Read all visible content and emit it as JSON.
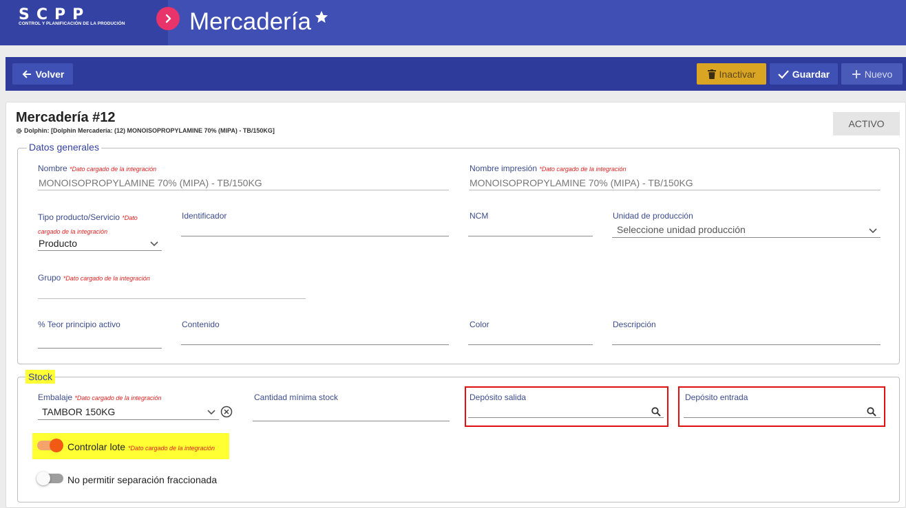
{
  "header": {
    "logo": "SCPP",
    "logo_subtitle": "CONTROL Y PLANIFICACIÓN DE LA PRODUCIÓN",
    "title": "Mercadería",
    "colors": {
      "header_bg": "#3f4fb4",
      "accent": "#e8336b"
    }
  },
  "toolbar": {
    "back_label": "Volver",
    "inactivate_label": "Inactivar",
    "save_label": "Guardar",
    "new_label": "Nuevo"
  },
  "record": {
    "title": "Mercadería #12",
    "source_info": "Dolphin: [Dolphin Mercadería: (12) MONOISOPROPYLAMINE 70% (MIPA) - TB/150KG]",
    "status": "ACTIVO"
  },
  "datos_generales": {
    "legend": "Datos generales",
    "integration_note": "*Dato cargado de la integración",
    "nombre": {
      "label": "Nombre",
      "value": "MONOISOPROPYLAMINE 70% (MIPA) - TB/150KG"
    },
    "nombre_impresion": {
      "label": "Nombre impresión",
      "value": "MONOISOPROPYLAMINE 70% (MIPA) - TB/150KG"
    },
    "tipo_producto": {
      "label": "Tipo producto/Servicio",
      "note_line1": "*Dato",
      "note_line2": "cargado de la integración",
      "value": "Producto"
    },
    "identificador": {
      "label": "Identificador",
      "value": ""
    },
    "ncm": {
      "label": "NCM",
      "value": ""
    },
    "unidad_produccion": {
      "label": "Unidad de producción",
      "placeholder": "Seleccione unidad producción"
    },
    "grupo": {
      "label": "Grupo",
      "value": ""
    },
    "teor": {
      "label": "% Teor principio activo",
      "value": ""
    },
    "contenido": {
      "label": "Contenido",
      "value": ""
    },
    "color": {
      "label": "Color",
      "value": ""
    },
    "descripcion": {
      "label": "Descripción",
      "value": ""
    }
  },
  "stock": {
    "legend": "Stock",
    "embalaje": {
      "label": "Embalaje",
      "value": "TAMBOR 150KG"
    },
    "cantidad_minima": {
      "label": "Cantidad mínima stock",
      "value": ""
    },
    "deposito_salida": {
      "label": "Depósito salida",
      "value": ""
    },
    "deposito_entrada": {
      "label": "Depósito entrada",
      "value": ""
    },
    "controlar_lote": {
      "label": "Controlar lote",
      "checked": true
    },
    "no_permitir": {
      "label": "No permitir separación fraccionada",
      "checked": false
    }
  }
}
